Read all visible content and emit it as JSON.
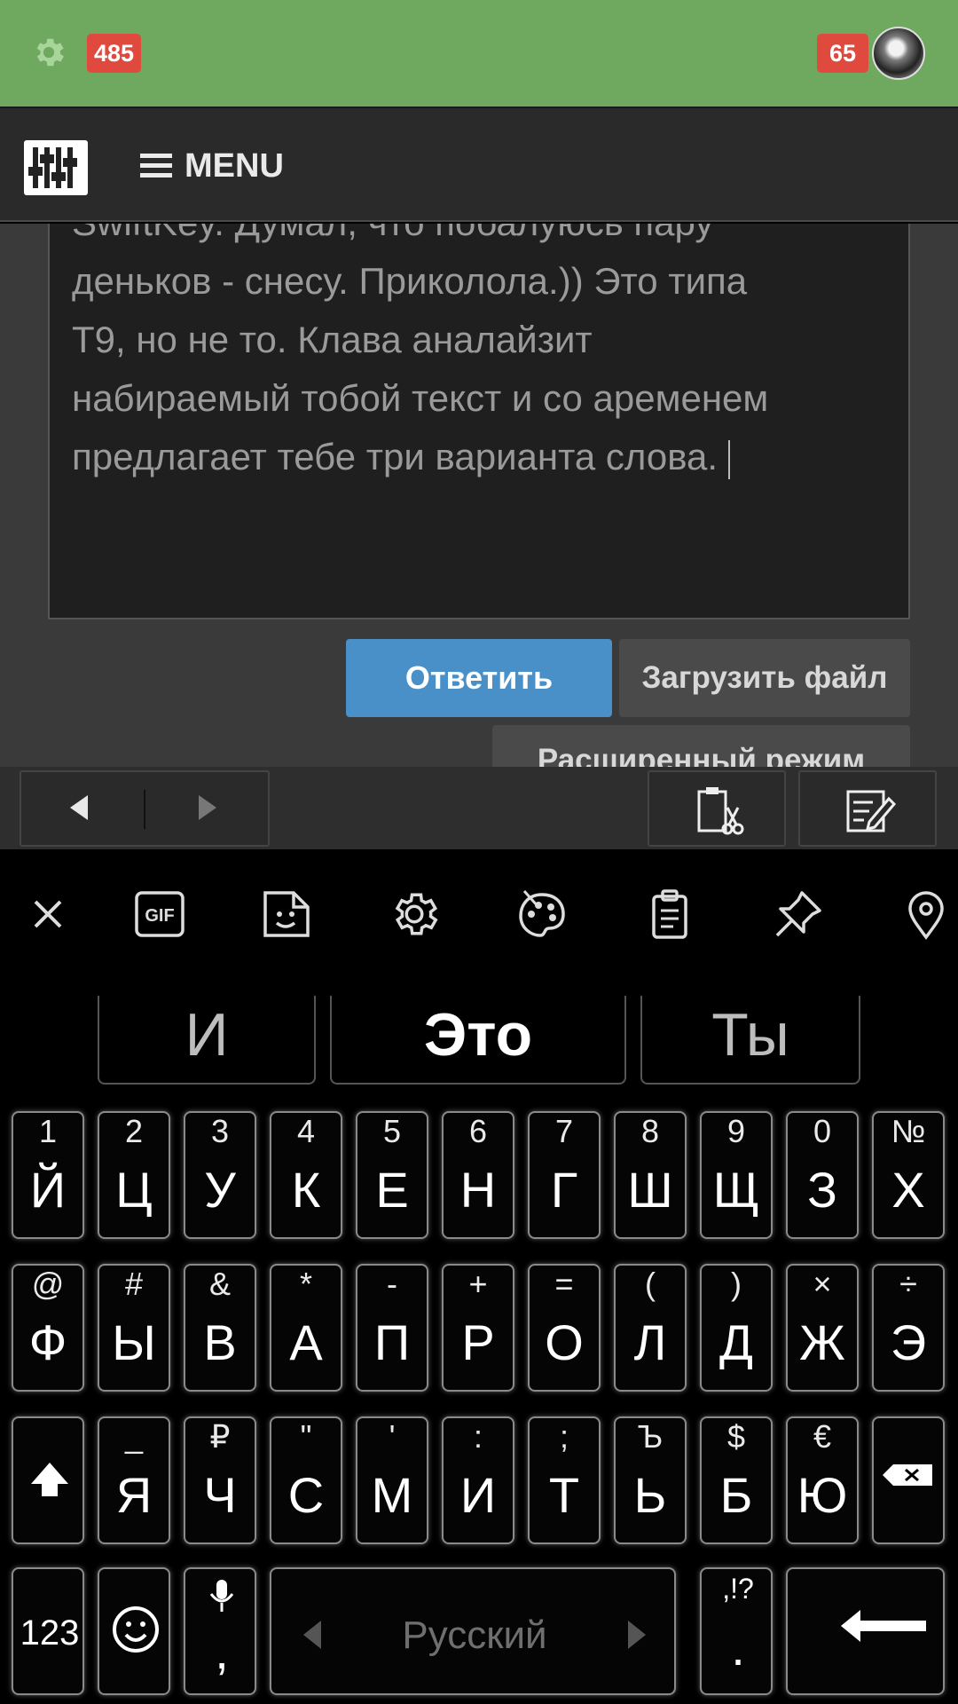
{
  "topbar": {
    "left_badge": "485",
    "right_badge": "65"
  },
  "header": {
    "menu_label": "MENU"
  },
  "editor": {
    "text_lines": [
      "SwiftKey. Думал, что побалуюсь пару",
      "деньков - снесу. Приколола.)) Это типа",
      "Т9, но не то. Клава аналайзит",
      "набираемый тобой текст и со аременем",
      "предлагает тебе три варианта слова."
    ],
    "reply_label": "Ответить",
    "upload_label": "Загрузить файл",
    "advanced_label": "Расширенный режим"
  },
  "keyboard": {
    "toolbar_icons": [
      "close-icon",
      "gif-icon",
      "sticker-icon",
      "settings-icon",
      "palette-icon",
      "clipboard-icon",
      "pin-icon",
      "location-icon"
    ],
    "gif_label": "GIF",
    "suggestions": [
      "И",
      "Это",
      "Ты"
    ],
    "row1": [
      {
        "hint": "1",
        "key": "Й"
      },
      {
        "hint": "2",
        "key": "Ц"
      },
      {
        "hint": "3",
        "key": "У"
      },
      {
        "hint": "4",
        "key": "К"
      },
      {
        "hint": "5",
        "key": "Е"
      },
      {
        "hint": "6",
        "key": "Н"
      },
      {
        "hint": "7",
        "key": "Г"
      },
      {
        "hint": "8",
        "key": "Ш"
      },
      {
        "hint": "9",
        "key": "Щ"
      },
      {
        "hint": "0",
        "key": "З"
      },
      {
        "hint": "№",
        "key": "Х"
      }
    ],
    "row2": [
      {
        "hint": "@",
        "key": "Ф"
      },
      {
        "hint": "#",
        "key": "Ы"
      },
      {
        "hint": "&",
        "key": "В"
      },
      {
        "hint": "*",
        "key": "А"
      },
      {
        "hint": "-",
        "key": "П"
      },
      {
        "hint": "+",
        "key": "Р"
      },
      {
        "hint": "=",
        "key": "О"
      },
      {
        "hint": "(",
        "key": "Л"
      },
      {
        "hint": ")",
        "key": "Д"
      },
      {
        "hint": "×",
        "key": "Ж"
      },
      {
        "hint": "÷",
        "key": "Э"
      }
    ],
    "row3": [
      {
        "hint": "_",
        "key": "Я"
      },
      {
        "hint": "₽",
        "key": "Ч"
      },
      {
        "hint": "\"",
        "key": "С"
      },
      {
        "hint": "'",
        "key": "М"
      },
      {
        "hint": ":",
        "key": "И"
      },
      {
        "hint": ";",
        "key": "Т"
      },
      {
        "hint": "Ъ",
        "key": "Ь"
      },
      {
        "hint": "$",
        "key": "Б"
      },
      {
        "hint": "€",
        "key": "Ю"
      }
    ],
    "numbers_label": "123",
    "comma": ",",
    "space_label": "Русский",
    "period_hint": ",!?",
    "period": "."
  }
}
